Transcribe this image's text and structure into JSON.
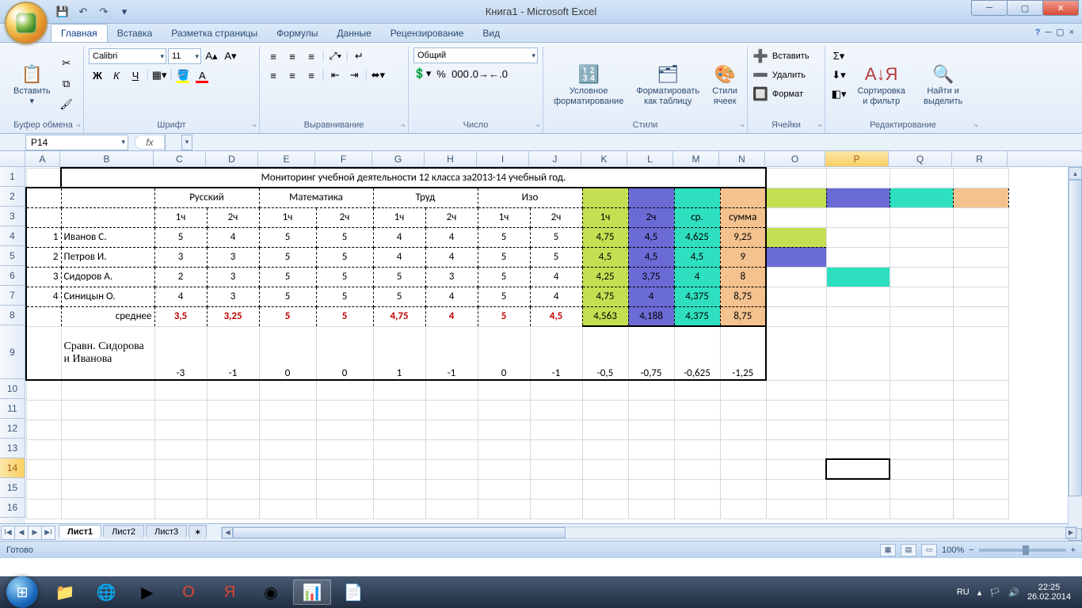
{
  "window": {
    "title": "Книга1 - Microsoft Excel"
  },
  "qat": {
    "save": "💾",
    "undo": "↶",
    "redo": "↷"
  },
  "tabs": [
    "Главная",
    "Вставка",
    "Разметка страницы",
    "Формулы",
    "Данные",
    "Рецензирование",
    "Вид"
  ],
  "ribbon": {
    "clipboard": {
      "label": "Буфер обмена",
      "paste": "Вставить"
    },
    "font": {
      "label": "Шрифт",
      "font_name": "Calibri",
      "font_size": "11"
    },
    "alignment": {
      "label": "Выравнивание"
    },
    "number": {
      "label": "Число",
      "format": "Общий"
    },
    "styles": {
      "label": "Стили",
      "cond": "Условное форматирование",
      "table": "Форматировать как таблицу",
      "cell": "Стили ячеек"
    },
    "cells": {
      "label": "Ячейки",
      "insert": "Вставить",
      "delete": "Удалить",
      "format": "Формат"
    },
    "editing": {
      "label": "Редактирование",
      "sort": "Сортировка и фильтр",
      "find": "Найти и выделить"
    }
  },
  "namebox": "P14",
  "columns": [
    "A",
    "B",
    "C",
    "D",
    "E",
    "F",
    "G",
    "H",
    "I",
    "J",
    "K",
    "L",
    "M",
    "N",
    "O",
    "P",
    "Q",
    "R"
  ],
  "row_nums": [
    "1",
    "2",
    "3",
    "4",
    "5",
    "6",
    "7",
    "8",
    "9",
    "10",
    "11",
    "12",
    "13",
    "14",
    "15",
    "16"
  ],
  "data": {
    "title": "Мониторинг учебной деятельности 12 класса за2013-14 учебный год.",
    "subjects": [
      "Русский",
      "Математика",
      "Труд",
      "Изо"
    ],
    "quarters": [
      "1ч",
      "2ч",
      "1ч",
      "2ч",
      "1ч",
      "2ч",
      "1ч",
      "2ч"
    ],
    "summary_hdr": [
      "1ч",
      "2ч",
      "ср.",
      "сумма"
    ],
    "students": [
      {
        "n": "1",
        "name": "Иванов С.",
        "v": [
          "5",
          "4",
          "5",
          "5",
          "4",
          "4",
          "5",
          "5"
        ],
        "s": [
          "4,75",
          "4,5",
          "4,625",
          "9,25"
        ]
      },
      {
        "n": "2",
        "name": "Петров И.",
        "v": [
          "3",
          "3",
          "5",
          "5",
          "4",
          "4",
          "5",
          "5"
        ],
        "s": [
          "4,5",
          "4,5",
          "4,5",
          "9"
        ]
      },
      {
        "n": "3",
        "name": "Сидоров А.",
        "v": [
          "2",
          "3",
          "5",
          "5",
          "5",
          "3",
          "5",
          "4"
        ],
        "s": [
          "4,25",
          "3,75",
          "4",
          "8"
        ]
      },
      {
        "n": "4",
        "name": "Синицын О.",
        "v": [
          "4",
          "3",
          "5",
          "5",
          "5",
          "4",
          "5",
          "4"
        ],
        "s": [
          "4,75",
          "4",
          "4,375",
          "8,75"
        ]
      }
    ],
    "average_label": "среднее",
    "average": [
      "3,5",
      "3,25",
      "5",
      "5",
      "4,75",
      "4",
      "5",
      "4,5"
    ],
    "average_s": [
      "4,563",
      "4,188",
      "4,375",
      "8,75"
    ],
    "compare_label": "Сравн. Сидорова и Иванова",
    "compare": [
      "-3",
      "-1",
      "0",
      "0",
      "1",
      "-1",
      "0",
      "-1"
    ],
    "compare_s": [
      "-0,5",
      "-0,75",
      "-0,625",
      "-1,25"
    ]
  },
  "sheets": [
    "Лист1",
    "Лист2",
    "Лист3"
  ],
  "status": {
    "ready": "Готово",
    "zoom": "100%"
  },
  "tray": {
    "lang": "RU",
    "time": "22:25",
    "date": "26.02.2014"
  }
}
